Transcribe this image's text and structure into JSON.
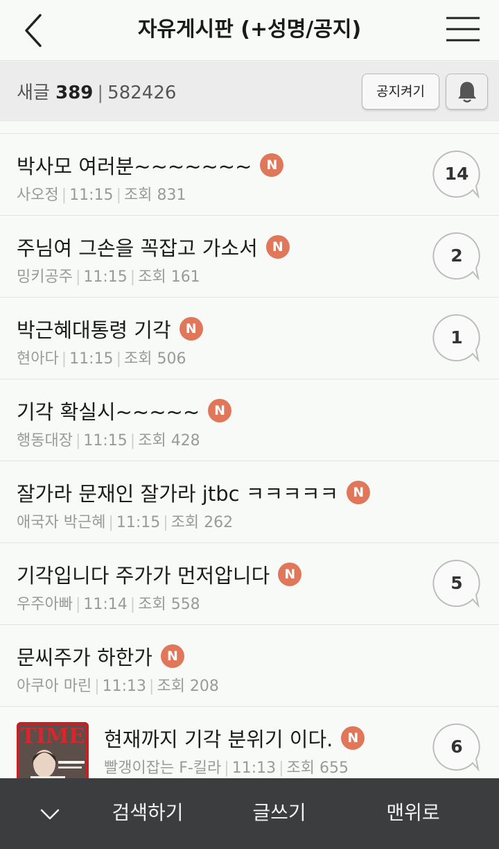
{
  "header": {
    "title": "자유게시판 (+성명/공지)",
    "back_icon": "chevron-left-icon",
    "menu_icon": "hamburger-menu-icon"
  },
  "subbar": {
    "new_label": "새글",
    "new_count": "389",
    "separator": "|",
    "total_count": "582426",
    "notice_button": "공지켜기",
    "bell_icon": "bell-icon"
  },
  "badge": {
    "new": "N",
    "color": "#e0775a"
  },
  "posts": [
    {
      "title": "박사모 여러분~~~~~~~",
      "author": "사오정",
      "time": "11:15",
      "views_label": "조회 831",
      "comments": "14"
    },
    {
      "title": "주님여 그손을 꼭잡고 가소서",
      "author": "밍키공주",
      "time": "11:15",
      "views_label": "조회 161",
      "comments": "2"
    },
    {
      "title": "박근혜대통령 기각",
      "author": "현아다",
      "time": "11:15",
      "views_label": "조회 506",
      "comments": "1"
    },
    {
      "title": "기각 확실시~~~~~",
      "author": "행동대장",
      "time": "11:15",
      "views_label": "조회 428",
      "comments": ""
    },
    {
      "title": "잘가라 문재인 잘가라 jtbc ㅋㅋㅋㅋㅋ",
      "author": "애국자 박근혜",
      "time": "11:15",
      "views_label": "조회 262",
      "comments": ""
    },
    {
      "title": "기각입니다 주가가 먼저압니다",
      "author": "우주아빠",
      "time": "11:14",
      "views_label": "조회 558",
      "comments": "5"
    },
    {
      "title": "문씨주가 하한가",
      "author": "아쿠아 마린",
      "time": "11:13",
      "views_label": "조회 208",
      "comments": ""
    },
    {
      "title": "현재까지 기각 분위기 이다.",
      "author": "빨갱이잡는 F-킬라",
      "time": "11:13",
      "views_label": "조회 655",
      "comments": "6",
      "thumbnail_text": "TIME"
    }
  ],
  "bottom": {
    "collapse_icon": "chevron-down-icon",
    "search": "검색하기",
    "write": "글쓰기",
    "top": "맨위로"
  }
}
